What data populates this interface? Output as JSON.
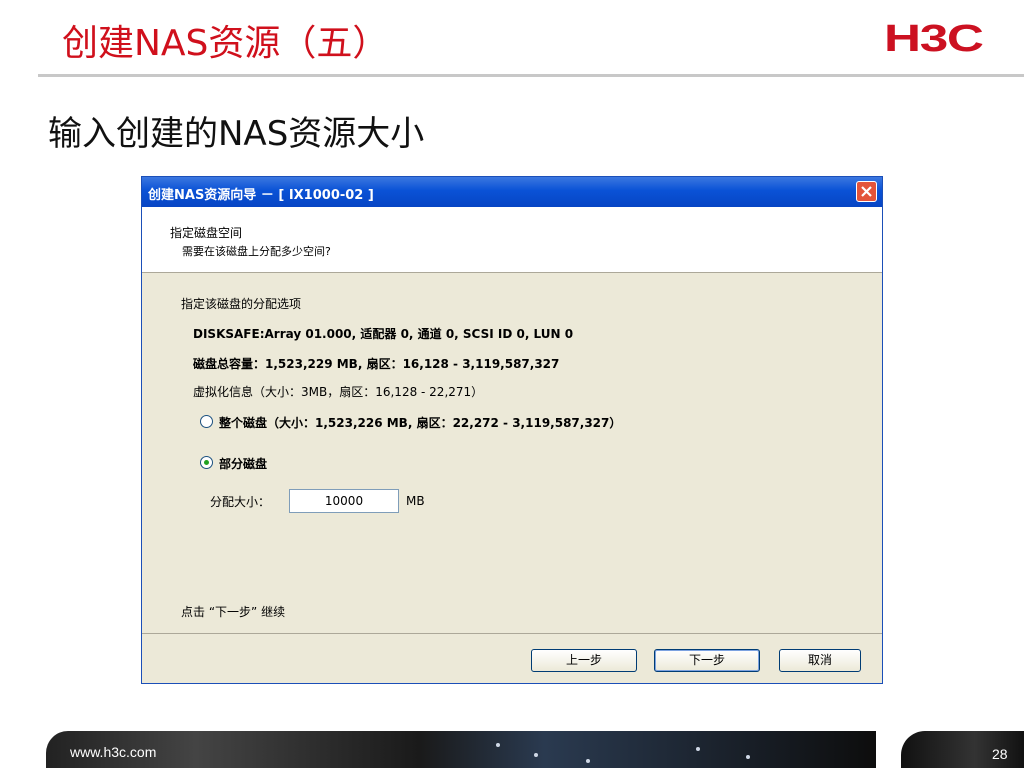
{
  "slide": {
    "title": "创建NAS资源（五）",
    "subtitle": "输入创建的NAS资源大小",
    "logo": "H3C",
    "footer_url": "www.h3c.com",
    "page_number": "28"
  },
  "dialog": {
    "title": "创建NAS资源向导 － [ IX1000-02 ]",
    "header": {
      "title": "指定磁盘空间",
      "description": "需要在该磁盘上分配多少空间?"
    },
    "section_label": "指定该磁盘的分配选项",
    "disk_info": "DISKSAFE:Array 01.000, 适配器 0, 通道 0, SCSI ID 0, LUN 0",
    "total_capacity": "磁盘总容量：1,523,229 MB, 扇区：16,128 - 3,119,587,327",
    "virtualization_info": "虚拟化信息（大小：3MB，扇区：16,128 - 22,271）",
    "options": [
      {
        "label": "整个磁盘（大小：1,523,226 MB, 扇区：22,272 - 3,119,587,327）",
        "selected": false
      },
      {
        "label": "部分磁盘",
        "selected": true
      }
    ],
    "size_field": {
      "label": "分配大小：",
      "value": "10000",
      "unit": "MB"
    },
    "hint": "点击 “下一步” 继续",
    "buttons": {
      "back": "上一步",
      "next": "下一步",
      "cancel": "取消"
    },
    "colors": {
      "titlebar": "#0a52d6",
      "body": "#ece9d8",
      "close": "#e3543a"
    }
  }
}
